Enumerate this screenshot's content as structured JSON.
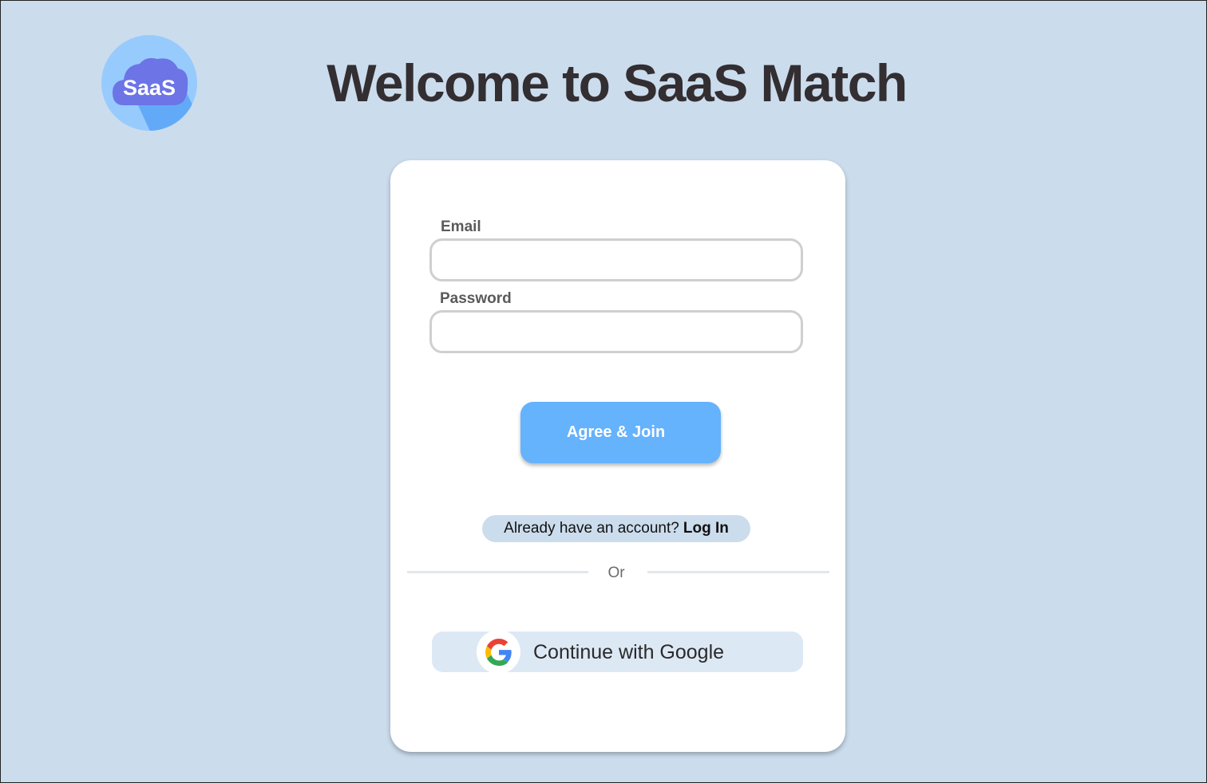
{
  "logo": {
    "text": "SaaS",
    "icon": "saas-cloud-logo"
  },
  "header": {
    "title": "Welcome to SaaS Match"
  },
  "form": {
    "email_label": "Email",
    "email_value": "",
    "password_label": "Password",
    "password_value": "",
    "submit_label": "Agree & Join",
    "login_prompt": "Already have an account?",
    "login_link": "Log In",
    "divider_text": "Or",
    "google_label": "Continue with Google",
    "google_icon": "google-icon"
  },
  "colors": {
    "background": "#cbdced",
    "primary": "#65b2fd",
    "title": "#332e31",
    "google_button_bg": "#dde8f5"
  }
}
